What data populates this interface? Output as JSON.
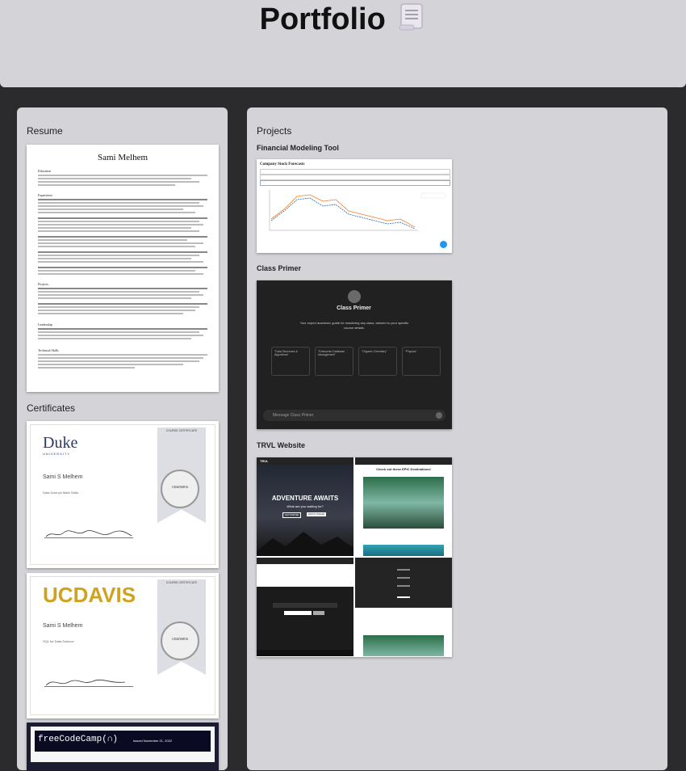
{
  "header": {
    "title": "Portfolio",
    "icon": "scroll-icon"
  },
  "resume": {
    "heading": "Resume",
    "name": "Sami Melhem",
    "sections": [
      "Education",
      "Experience",
      "Projects",
      "Leadership",
      "Technical Skills"
    ]
  },
  "certificates": {
    "heading": "Certificates",
    "items": [
      {
        "org": "Duke",
        "org_sub": "UNIVERSITY",
        "badge": "COURSE CERTIFICATE",
        "name": "Sami S Melhem",
        "course": "Data Science Math Skills",
        "seal": "coursera"
      },
      {
        "org_a": "UC",
        "org_b": "DAVIS",
        "badge": "COURSE CERTIFICATE",
        "name": "Sami S Melhem",
        "course": "SQL for Data Science",
        "seal": "coursera"
      },
      {
        "org": "freeCodeCamp(∩)",
        "date": "Issued November 21, 2022"
      }
    ]
  },
  "projects": {
    "heading": "Projects",
    "items": [
      {
        "title": "Financial Modeling Tool",
        "app_title": "Company Stock Forecasts"
      },
      {
        "title": "Class Primer",
        "app_title": "Class Primer",
        "app_subtitle": "Your expert academic guide for mastering any class, tailored to your specific course details.",
        "cards": [
          "\"Data Structures & Algorithms\"",
          "\"Enterprise Database Management\"",
          "\"Organic Chemistry\"",
          "\"Physics\""
        ],
        "input_placeholder": "Message Class Primer"
      },
      {
        "title": "TRVL Website",
        "hero": "ADVENTURE AWAITS",
        "hero_sub": "What are you waiting for?",
        "btn_a": "GET STARTED",
        "btn_b": "WATCH TRAILER",
        "section": "Check out these EPIC Destinations!",
        "logo": "TRVL"
      }
    ]
  }
}
